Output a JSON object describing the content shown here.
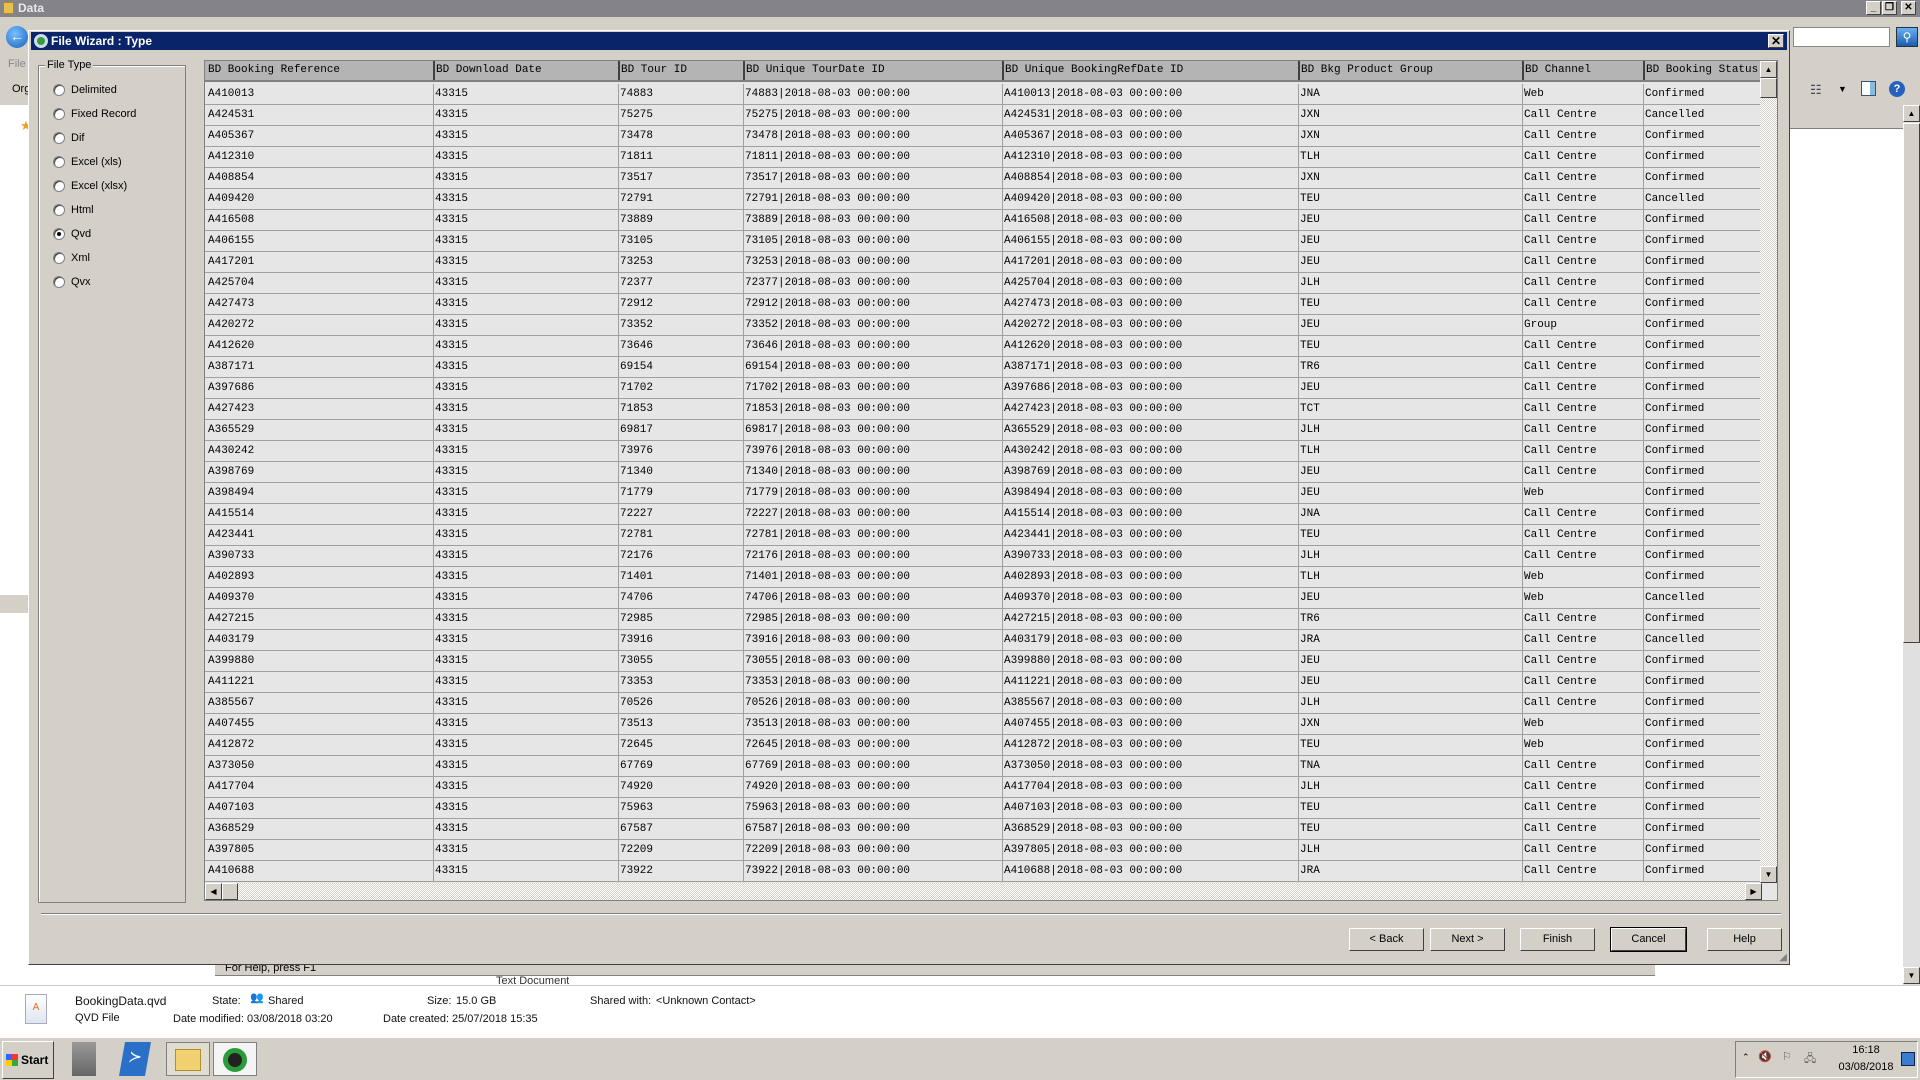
{
  "explorer": {
    "title": "Data",
    "menu_file": "File",
    "menu_organize": "Org",
    "status_help": "For Help, press F1",
    "behind_type": "Text Document"
  },
  "wizard": {
    "title": "File Wizard : Type",
    "file_type_legend": "File Type",
    "file_types": [
      {
        "label": "Delimited",
        "selected": false
      },
      {
        "label": "Fixed Record",
        "selected": false
      },
      {
        "label": "Dif",
        "selected": false
      },
      {
        "label": "Excel (xls)",
        "selected": false
      },
      {
        "label": "Excel (xlsx)",
        "selected": false
      },
      {
        "label": "Html",
        "selected": false
      },
      {
        "label": "Qvd",
        "selected": true
      },
      {
        "label": "Xml",
        "selected": false
      },
      {
        "label": "Qvx",
        "selected": false
      }
    ],
    "columns": [
      "BD Booking Reference",
      "BD Download Date",
      "BD Tour ID",
      "BD Unique TourDate ID",
      "BD Unique BookingRefDate ID",
      "BD Bkg Product Group",
      "BD Channel",
      "BD Booking Status"
    ],
    "rows": [
      [
        "A410013",
        "43315",
        "74883",
        "74883|2018-08-03 00:00:00",
        "A410013|2018-08-03 00:00:00",
        "JNA",
        "Web",
        "Confirmed"
      ],
      [
        "A424531",
        "43315",
        "75275",
        "75275|2018-08-03 00:00:00",
        "A424531|2018-08-03 00:00:00",
        "JXN",
        "Call Centre",
        "Cancelled"
      ],
      [
        "A405367",
        "43315",
        "73478",
        "73478|2018-08-03 00:00:00",
        "A405367|2018-08-03 00:00:00",
        "JXN",
        "Call Centre",
        "Confirmed"
      ],
      [
        "A412310",
        "43315",
        "71811",
        "71811|2018-08-03 00:00:00",
        "A412310|2018-08-03 00:00:00",
        "TLH",
        "Call Centre",
        "Confirmed"
      ],
      [
        "A408854",
        "43315",
        "73517",
        "73517|2018-08-03 00:00:00",
        "A408854|2018-08-03 00:00:00",
        "JXN",
        "Call Centre",
        "Confirmed"
      ],
      [
        "A409420",
        "43315",
        "72791",
        "72791|2018-08-03 00:00:00",
        "A409420|2018-08-03 00:00:00",
        "TEU",
        "Call Centre",
        "Cancelled"
      ],
      [
        "A416508",
        "43315",
        "73889",
        "73889|2018-08-03 00:00:00",
        "A416508|2018-08-03 00:00:00",
        "JEU",
        "Call Centre",
        "Confirmed"
      ],
      [
        "A406155",
        "43315",
        "73105",
        "73105|2018-08-03 00:00:00",
        "A406155|2018-08-03 00:00:00",
        "JEU",
        "Call Centre",
        "Confirmed"
      ],
      [
        "A417201",
        "43315",
        "73253",
        "73253|2018-08-03 00:00:00",
        "A417201|2018-08-03 00:00:00",
        "JEU",
        "Call Centre",
        "Confirmed"
      ],
      [
        "A425704",
        "43315",
        "72377",
        "72377|2018-08-03 00:00:00",
        "A425704|2018-08-03 00:00:00",
        "JLH",
        "Call Centre",
        "Confirmed"
      ],
      [
        "A427473",
        "43315",
        "72912",
        "72912|2018-08-03 00:00:00",
        "A427473|2018-08-03 00:00:00",
        "TEU",
        "Call Centre",
        "Confirmed"
      ],
      [
        "A420272",
        "43315",
        "73352",
        "73352|2018-08-03 00:00:00",
        "A420272|2018-08-03 00:00:00",
        "JEU",
        "Group",
        "Confirmed"
      ],
      [
        "A412620",
        "43315",
        "73646",
        "73646|2018-08-03 00:00:00",
        "A412620|2018-08-03 00:00:00",
        "TEU",
        "Call Centre",
        "Confirmed"
      ],
      [
        "A387171",
        "43315",
        "69154",
        "69154|2018-08-03 00:00:00",
        "A387171|2018-08-03 00:00:00",
        "TR6",
        "Call Centre",
        "Confirmed"
      ],
      [
        "A397686",
        "43315",
        "71702",
        "71702|2018-08-03 00:00:00",
        "A397686|2018-08-03 00:00:00",
        "JEU",
        "Call Centre",
        "Confirmed"
      ],
      [
        "A427423",
        "43315",
        "71853",
        "71853|2018-08-03 00:00:00",
        "A427423|2018-08-03 00:00:00",
        "TCT",
        "Call Centre",
        "Confirmed"
      ],
      [
        "A365529",
        "43315",
        "69817",
        "69817|2018-08-03 00:00:00",
        "A365529|2018-08-03 00:00:00",
        "JLH",
        "Call Centre",
        "Confirmed"
      ],
      [
        "A430242",
        "43315",
        "73976",
        "73976|2018-08-03 00:00:00",
        "A430242|2018-08-03 00:00:00",
        "TLH",
        "Call Centre",
        "Confirmed"
      ],
      [
        "A398769",
        "43315",
        "71340",
        "71340|2018-08-03 00:00:00",
        "A398769|2018-08-03 00:00:00",
        "JEU",
        "Call Centre",
        "Confirmed"
      ],
      [
        "A398494",
        "43315",
        "71779",
        "71779|2018-08-03 00:00:00",
        "A398494|2018-08-03 00:00:00",
        "JEU",
        "Web",
        "Confirmed"
      ],
      [
        "A415514",
        "43315",
        "72227",
        "72227|2018-08-03 00:00:00",
        "A415514|2018-08-03 00:00:00",
        "JNA",
        "Call Centre",
        "Confirmed"
      ],
      [
        "A423441",
        "43315",
        "72781",
        "72781|2018-08-03 00:00:00",
        "A423441|2018-08-03 00:00:00",
        "TEU",
        "Call Centre",
        "Confirmed"
      ],
      [
        "A390733",
        "43315",
        "72176",
        "72176|2018-08-03 00:00:00",
        "A390733|2018-08-03 00:00:00",
        "JLH",
        "Call Centre",
        "Confirmed"
      ],
      [
        "A402893",
        "43315",
        "71401",
        "71401|2018-08-03 00:00:00",
        "A402893|2018-08-03 00:00:00",
        "TLH",
        "Web",
        "Confirmed"
      ],
      [
        "A409370",
        "43315",
        "74706",
        "74706|2018-08-03 00:00:00",
        "A409370|2018-08-03 00:00:00",
        "JEU",
        "Web",
        "Cancelled"
      ],
      [
        "A427215",
        "43315",
        "72985",
        "72985|2018-08-03 00:00:00",
        "A427215|2018-08-03 00:00:00",
        "TR6",
        "Call Centre",
        "Confirmed"
      ],
      [
        "A403179",
        "43315",
        "73916",
        "73916|2018-08-03 00:00:00",
        "A403179|2018-08-03 00:00:00",
        "JRA",
        "Call Centre",
        "Cancelled"
      ],
      [
        "A399880",
        "43315",
        "73055",
        "73055|2018-08-03 00:00:00",
        "A399880|2018-08-03 00:00:00",
        "JEU",
        "Call Centre",
        "Confirmed"
      ],
      [
        "A411221",
        "43315",
        "73353",
        "73353|2018-08-03 00:00:00",
        "A411221|2018-08-03 00:00:00",
        "JEU",
        "Call Centre",
        "Confirmed"
      ],
      [
        "A385567",
        "43315",
        "70526",
        "70526|2018-08-03 00:00:00",
        "A385567|2018-08-03 00:00:00",
        "JLH",
        "Call Centre",
        "Confirmed"
      ],
      [
        "A407455",
        "43315",
        "73513",
        "73513|2018-08-03 00:00:00",
        "A407455|2018-08-03 00:00:00",
        "JXN",
        "Web",
        "Confirmed"
      ],
      [
        "A412872",
        "43315",
        "72645",
        "72645|2018-08-03 00:00:00",
        "A412872|2018-08-03 00:00:00",
        "TEU",
        "Web",
        "Confirmed"
      ],
      [
        "A373050",
        "43315",
        "67769",
        "67769|2018-08-03 00:00:00",
        "A373050|2018-08-03 00:00:00",
        "TNA",
        "Call Centre",
        "Confirmed"
      ],
      [
        "A417704",
        "43315",
        "74920",
        "74920|2018-08-03 00:00:00",
        "A417704|2018-08-03 00:00:00",
        "JLH",
        "Call Centre",
        "Confirmed"
      ],
      [
        "A407103",
        "43315",
        "75963",
        "75963|2018-08-03 00:00:00",
        "A407103|2018-08-03 00:00:00",
        "TEU",
        "Call Centre",
        "Confirmed"
      ],
      [
        "A368529",
        "43315",
        "67587",
        "67587|2018-08-03 00:00:00",
        "A368529|2018-08-03 00:00:00",
        "TEU",
        "Call Centre",
        "Confirmed"
      ],
      [
        "A397805",
        "43315",
        "72209",
        "72209|2018-08-03 00:00:00",
        "A397805|2018-08-03 00:00:00",
        "JLH",
        "Call Centre",
        "Confirmed"
      ],
      [
        "A410688",
        "43315",
        "73922",
        "73922|2018-08-03 00:00:00",
        "A410688|2018-08-03 00:00:00",
        "JRA",
        "Call Centre",
        "Confirmed"
      ]
    ],
    "buttons": {
      "back": "< Back",
      "next": "Next >",
      "finish": "Finish",
      "cancel": "Cancel",
      "help": "Help"
    }
  },
  "details": {
    "file_name": "BookingData.qvd",
    "file_type": "QVD File",
    "state_label": "State:",
    "state_value": "Shared",
    "size_label": "Size:",
    "size_value": "15.0 GB",
    "shared_label": "Shared with:",
    "shared_value": "<Unknown Contact>",
    "modified_label": "Date modified:",
    "modified_value": "03/08/2018 03:20",
    "created_label": "Date created:",
    "created_value": "25/07/2018 15:35"
  },
  "taskbar": {
    "start": "Start",
    "time": "16:18",
    "date": "03/08/2018"
  },
  "colors": {
    "titlebar": "#0a246a",
    "window": "#d4d0c8",
    "grid": "#e6e6e6",
    "header": "#b4b4b4"
  }
}
